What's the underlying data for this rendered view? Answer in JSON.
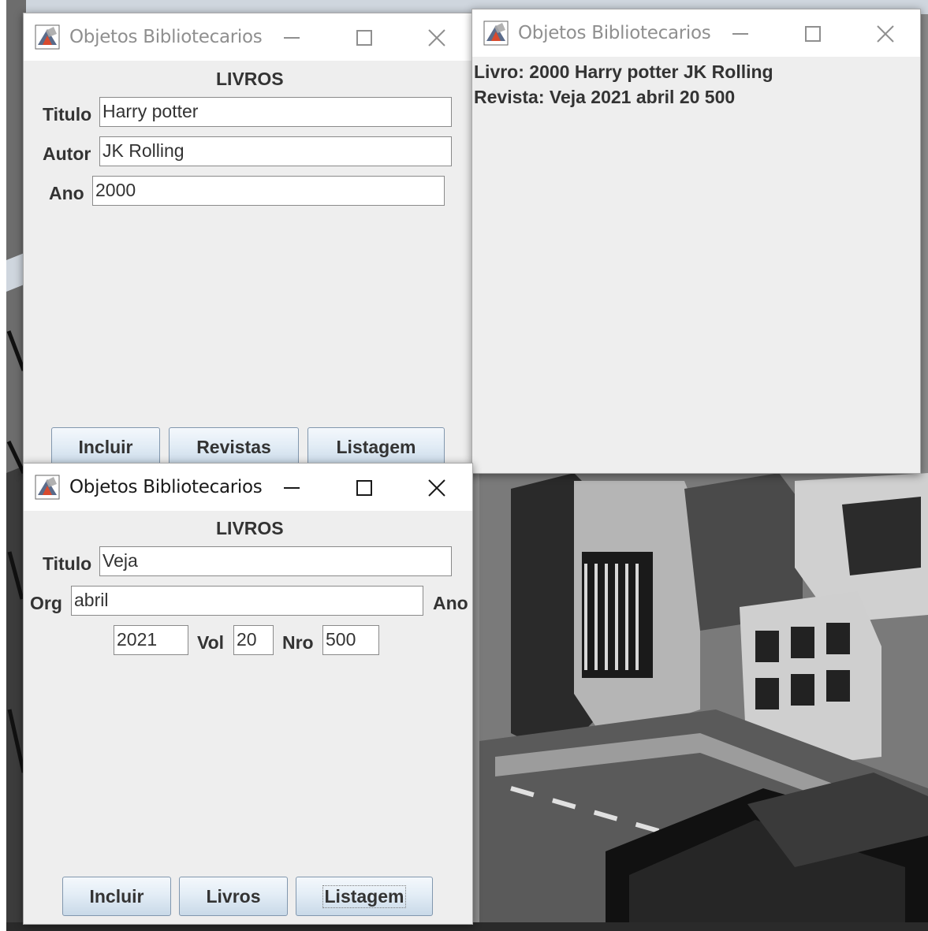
{
  "window_title": "Objetos Bibliotecarios",
  "books_window": {
    "heading": "LIVROS",
    "titulo_label": "Titulo",
    "titulo_value": "Harry potter",
    "autor_label": "Autor",
    "autor_value": "JK Rolling",
    "ano_label": "Ano",
    "ano_value": "2000",
    "buttons": {
      "incluir": "Incluir",
      "revistas": "Revistas",
      "listagem": "Listagem"
    }
  },
  "listing_window": {
    "lines": [
      "Livro: 2000 Harry potter JK Rolling",
      "Revista: Veja 2021 abril 20 500"
    ]
  },
  "magazine_window": {
    "heading": "LIVROS",
    "titulo_label": "Titulo",
    "titulo_value": "Veja",
    "org_label": "Org",
    "org_value": "abril",
    "ano_label": "Ano",
    "ano_value": "2021",
    "vol_label": "Vol",
    "vol_value": "20",
    "nro_label": "Nro",
    "nro_value": "500",
    "buttons": {
      "incluir": "Incluir",
      "livros": "Livros",
      "listagem": "Listagem"
    }
  },
  "icons": {
    "app": "java-app-icon",
    "minimize": "minimize-icon",
    "maximize": "maximize-icon",
    "close": "close-icon"
  },
  "colors": {
    "window_bg": "#eeeeee",
    "titlebar_bg": "#ffffff",
    "button_border": "#8197ae",
    "text": "#333333"
  }
}
